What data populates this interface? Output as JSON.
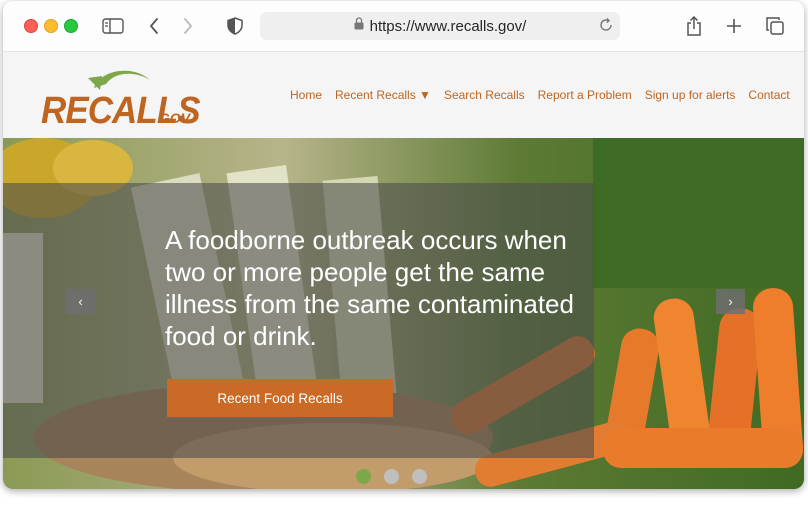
{
  "browser": {
    "url": "https://www.recalls.gov/"
  },
  "site": {
    "logo_main": "RECALLS",
    "logo_suffix": "GOV",
    "nav": {
      "home": "Home",
      "recent_recalls": "Recent Recalls ▼",
      "search_recalls": "Search Recalls",
      "report_problem": "Report a Problem",
      "signup_alerts": "Sign up for alerts",
      "contact": "Contact"
    }
  },
  "hero": {
    "headline": "A foodborne outbreak occurs when two or more people get the same illness from the same contaminated food or drink.",
    "button_label": "Recent Food Recalls",
    "prev_label": "‹",
    "next_label": "›",
    "slides_total": 3,
    "active_slide": 1
  },
  "colors": {
    "brand_orange": "#c0651f",
    "button_orange": "#c96a27",
    "dot_active": "#7da84a"
  }
}
